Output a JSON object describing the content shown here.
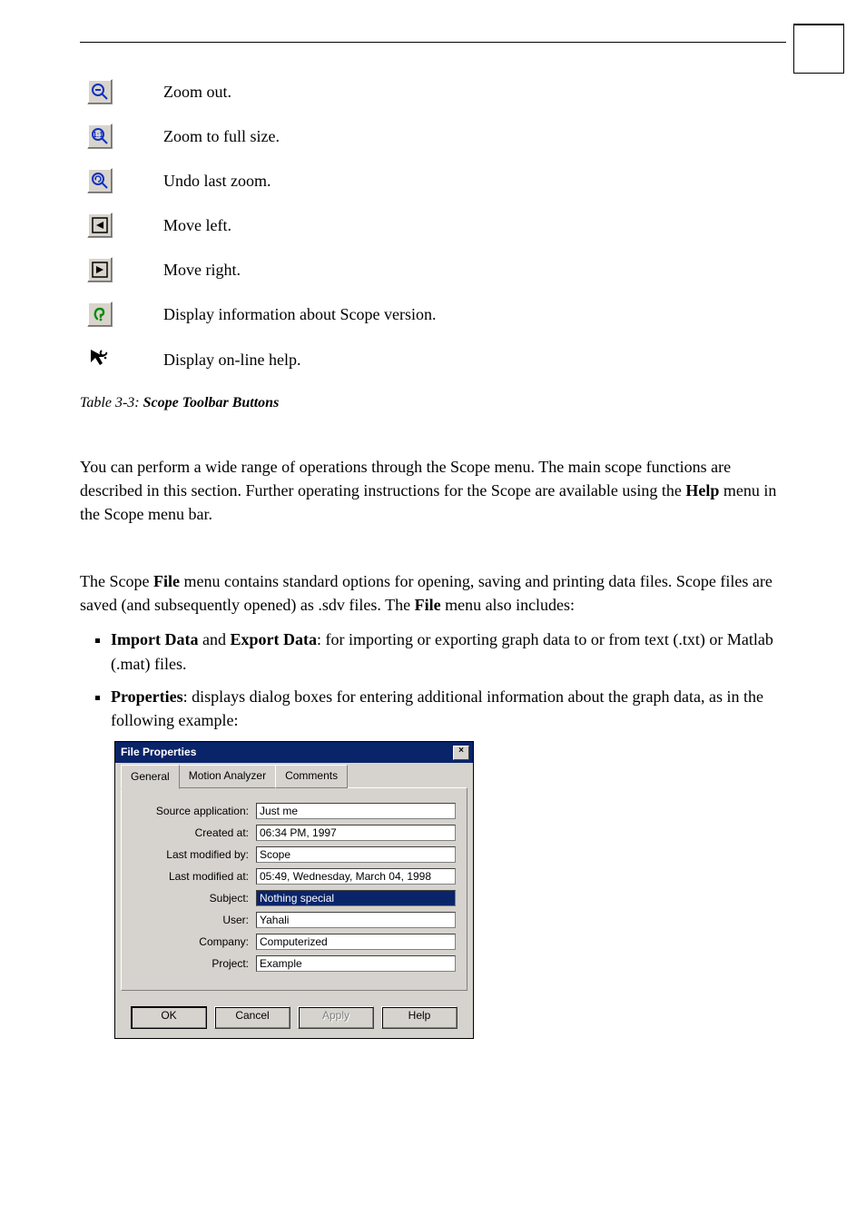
{
  "toolbar": {
    "rows": [
      {
        "icon": "zoom-out-icon",
        "label": "Zoom out."
      },
      {
        "icon": "zoom-full-icon",
        "label": "Zoom to full size."
      },
      {
        "icon": "undo-zoom-icon",
        "label": "Undo last zoom."
      },
      {
        "icon": "move-left-icon",
        "label": "Move left."
      },
      {
        "icon": "move-right-icon",
        "label": "Move right."
      },
      {
        "icon": "about-icon",
        "label": "Display information about Scope version."
      },
      {
        "icon": "help-icon",
        "label": "Display on-line help."
      }
    ]
  },
  "caption": {
    "prefix": "Table 3-3:",
    "title": "Scope Toolbar Buttons"
  },
  "para1": "You can perform a wide range of operations through the Scope menu. The main scope functions are described in this section. Further operating instructions for the Scope are available using the ",
  "para1_bold": "Help",
  "para1_suffix": " menu in the Scope menu bar.",
  "para2_a": "The Scope ",
  "para2_b": "File",
  "para2_c": " menu contains standard options for opening, saving and printing data files. Scope files are saved (and subsequently opened) as .sdv files. The ",
  "para2_d": "File",
  "para2_e": " menu also includes:",
  "bullet1": {
    "b1": "Import Data",
    "mid": " and ",
    "b2": "Export Data",
    "rest": ": for importing or exporting graph data to or from text (.txt) or Matlab (.mat) files."
  },
  "bullet2": {
    "b1": "Properties",
    "rest": ": displays dialog boxes for entering additional information about the graph data, as in the following example:"
  },
  "dialog": {
    "title": "File Properties",
    "tabs": {
      "general": "General",
      "motion": "Motion Analyzer",
      "comments": "Comments"
    },
    "fields": {
      "source_label": "Source application:",
      "source_value": "Just me",
      "created_label": "Created at:",
      "created_value": "06:34 PM, 1997",
      "modby_label": "Last modified by:",
      "modby_value": "Scope",
      "modat_label": "Last modified at:",
      "modat_value": "05:49, Wednesday, March 04, 1998",
      "subject_label": "Subject:",
      "subject_value": "Nothing special",
      "user_label": "User:",
      "user_value": "Yahali",
      "company_label": "Company:",
      "company_value": "Computerized",
      "project_label": "Project:",
      "project_value": "Example"
    },
    "buttons": {
      "ok": "OK",
      "cancel": "Cancel",
      "apply": "Apply",
      "help": "Help"
    }
  }
}
